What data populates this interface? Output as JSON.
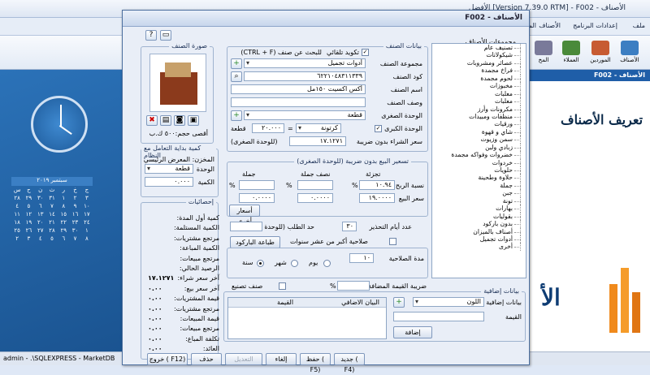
{
  "app": {
    "title": "الأفضل [Version 7.39.0 RTM] - F002 - الأصناف",
    "menu": [
      "ملف",
      "إعدادات البرنامج",
      "الأصناف",
      "المخازن"
    ],
    "ribbon": [
      {
        "label": "الأصناف",
        "icon": "items-icon"
      },
      {
        "label": "الموردين",
        "icon": "suppliers-icon"
      },
      {
        "label": "العملاء",
        "icon": "customers-icon"
      },
      {
        "label": "المخ",
        "icon": "stores-icon"
      }
    ],
    "doc_tab": "F002 - الأصناف",
    "banner": "تعريف الأصناف",
    "status": "admin - .\\SQLEXPRESS - MarketDB"
  },
  "calendar": {
    "month": "سبتمبر",
    "year": "٢٠١٩",
    "weekdays": [
      "س",
      "ح",
      "ن",
      "ث",
      "ر",
      "خ",
      "ج"
    ],
    "days": [
      "٢٨",
      "٢٩",
      "٣٠",
      "٣١",
      "١",
      "٢",
      "٣",
      "٤",
      "٥",
      "٦",
      "٧",
      "٨",
      "٩",
      "١٠",
      "١١",
      "١٢",
      "١٣",
      "١٤",
      "١٥",
      "١٦",
      "١٧",
      "١٨",
      "١٩",
      "٢٠",
      "٢١",
      "٢٢",
      "٢٣",
      "٢٤",
      "٢٥",
      "٢٦",
      "٢٧",
      "٢٨",
      "٢٩",
      "٣٠",
      "١",
      "٢",
      "٣",
      "٤",
      "٥",
      "٦",
      "٧",
      "٨"
    ]
  },
  "dialog": {
    "title": "F002 - الأصناف",
    "image_group": "صورة الصنف",
    "item_image_caption": "أقصى حجم:٥٠٠ ك.ب",
    "item_data_group": "بيانات الصنف",
    "auto_code_label": "تكويد تلقائي",
    "auto_code_checked": true,
    "search_hint": "للبحث عن صنف (CTRL + F)",
    "group_label": "مجموعة الصنف",
    "group_value": "أدوات تجميل",
    "code_label": "كود الصنف",
    "code_value": "٦٢٢١٠٤٨٣١١٣٣٩",
    "name_label": "اسم الصنف",
    "name_value": "أكس اكسيت ١٥٠مل",
    "desc_label": "وصف الصنف",
    "desc_value": "",
    "small_unit_label": "الوحدة الصغرى",
    "small_unit_value": "قطعة",
    "big_unit_label": "الوحدة الكبرى",
    "big_unit_checked": true,
    "big_unit_value": "كرتونة",
    "big_unit_qty": "٢٠.٠٠٠",
    "big_unit_qty_unit": "قطعة",
    "buy_price_label": "سعر الشراء بدون ضريبة",
    "buy_price_value": "١٧.١٢٧١",
    "buy_price_note": "(للوحدة الصغرى)",
    "pricing_group": "تسعير البيع بدون ضريبة (للوحدة الصغرى)",
    "col_retail": "تجزئة",
    "col_half": "نصف جملة",
    "col_whole": "جملة",
    "profit_label": "نسبة الربح",
    "profit_values": [
      "١٠.٩٤",
      "",
      ""
    ],
    "sell_label": "سعر البيع",
    "sell_values": [
      "١٩.٠٠٠٠",
      "٠.٠٠٠٠",
      "٠.٠٠٠٠"
    ],
    "percent_sign": "%",
    "prices_button": "أسعار أخرى",
    "warn_days_label": "عدد أيام التحذير",
    "warn_days_value": "٣٠",
    "reorder_label": "حد الطلب (للوحدة الصغرى)",
    "reorder_value": "",
    "barcode_button": "طباعة الباركود",
    "validity_label": "صلاحية أكبر من عشر سنوات",
    "validity_period_label": "مدة الصلاحية",
    "validity_period_value": "١٠",
    "unit_day": "يوم",
    "unit_month": "شهر",
    "unit_year": "سنة",
    "unit_selected": "year",
    "vat_label": "ضريبة القيمة المضافة - VAT",
    "vat_value": "",
    "manufacture_label": "صنف تصنيع",
    "groups_title": "مجموعات الأصناف",
    "groups": [
      "تصنيف عام",
      "شيكولاتات",
      "عصائر ومشروبات",
      "فراخ مجمدة",
      "لحوم مجمدة",
      "مخبوزات",
      "معلبات",
      "معلبات",
      "مكرونات وأرز",
      "منظفات ومبيدات",
      "ورقيات",
      "شاي و قهوة",
      "سمن وزيوت",
      "زبادي ولبن",
      "خضروات وفواكه مجمدة",
      "خردوات",
      "حلويات",
      "حلاوة وطحينة",
      "جملة",
      "جبن",
      "تونة",
      "بهارات",
      "بقوليات",
      "بدون باركود",
      "أصناف بالميزان",
      "أدوات تجميل",
      "أخرى"
    ],
    "deal_group": "كمية بداية التعامل مع النظام",
    "store_label": "المخزن:",
    "store_value": "المعرض الرئيسي",
    "unit_label": "الوحدة",
    "unit_value": "قطعة",
    "qty_label": "الكمية",
    "qty_value": "٠.٠٠٠",
    "stats_group": "إحصائيات",
    "stats": [
      {
        "label": "كمية أول المدة:",
        "value": ""
      },
      {
        "label": "الكمية المستلمة:",
        "value": ""
      },
      {
        "label": "مرتجع مشتريات:",
        "value": ""
      },
      {
        "label": "الكمية المباعة:",
        "value": ""
      },
      {
        "label": "مرتجع مبيعات:",
        "value": ""
      },
      {
        "label": "الرصيد الحالي:",
        "value": ""
      },
      {
        "label": "آخر سعر شراء:",
        "value": "١٧.١٢٧١"
      },
      {
        "label": "آخر سعر بيع:",
        "value": "٠.٠٠"
      },
      {
        "label": "قيمة المشتريات:",
        "value": "٠.٠٠"
      },
      {
        "label": "مرتجع مشتريات:",
        "value": "٠.٠٠"
      },
      {
        "label": "قيمة المبيعات:",
        "value": "٠.٠٠"
      },
      {
        "label": "مرتجع مبيعات:",
        "value": "٠.٠٠"
      },
      {
        "label": "تكلفة المباع:",
        "value": "٠.٠٠"
      },
      {
        "label": "العائد:",
        "value": "٠.٠٠"
      }
    ],
    "extra_group": "بيانات إضافية",
    "extra_data_label": "بيانات إضافية",
    "extra_data_value": "اللون",
    "extra_value_label": "القيمة",
    "extra_add_button": "إضافة",
    "extra_col_data": "البيان الاضافي",
    "extra_col_value": "القيمة",
    "buttons": [
      "جديد ( F4)",
      "حفظ ( F5)",
      "إلغاء",
      "التعديل",
      "حذف",
      "خروج ( F12)"
    ],
    "help_icon": "?"
  }
}
